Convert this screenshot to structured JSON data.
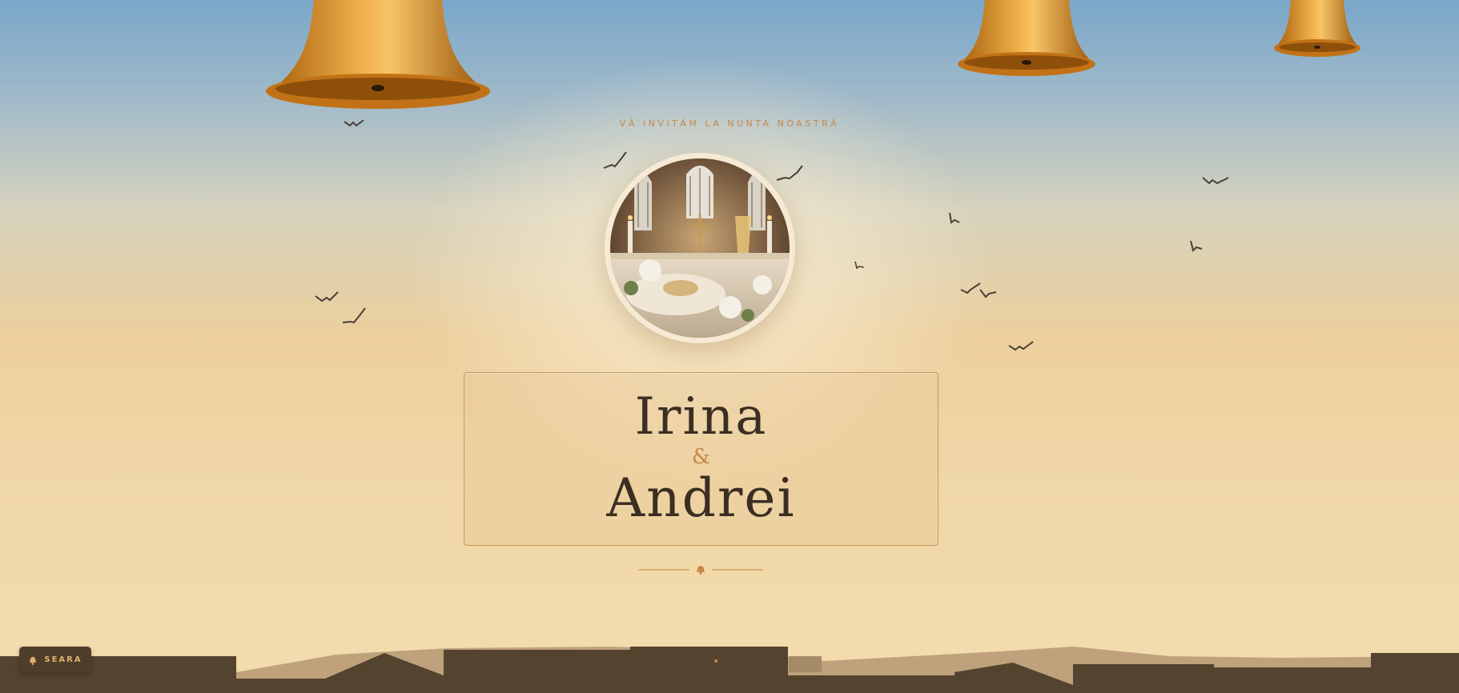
{
  "invitation": {
    "tagline": "VĂ INVITĂM LA NUNTA NOASTRĂ",
    "bride": "Irina",
    "ampersand": "&",
    "groom": "Andrei"
  },
  "controls": {
    "mode_button_label": "SEARA",
    "mode_icon": "bell-icon"
  },
  "colors": {
    "sky_top": "#7aa7c9",
    "sky_bottom": "#f3dcae",
    "bell": "#d0801f",
    "accent": "#c58747",
    "text_dark": "#3b2e22",
    "skyline": "#54432f"
  }
}
